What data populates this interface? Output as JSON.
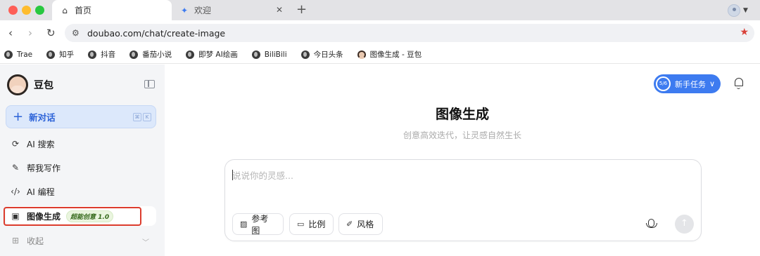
{
  "browser": {
    "tabs": [
      {
        "label": "首页",
        "icon": "home-icon"
      },
      {
        "label": "欢迎",
        "icon": "sparkle-icon"
      }
    ],
    "url": "doubao.com/chat/create-image",
    "bookmarks": [
      "Trae",
      "知乎",
      "抖音",
      "番茄小说",
      "即梦 AI绘画",
      "BiliBili",
      "今日头条",
      "图像生成 - 豆包"
    ]
  },
  "sidebar": {
    "brand": "豆包",
    "new_chat": "新对话",
    "shortcut_keys": [
      "⌘",
      "K"
    ],
    "items": [
      {
        "label": "AI 搜索",
        "icon": "search-icon"
      },
      {
        "label": "帮我写作",
        "icon": "pen-icon"
      },
      {
        "label": "AI 编程",
        "icon": "code-icon"
      },
      {
        "label": "图像生成",
        "icon": "image-plus-icon",
        "badge": "超能创意 1.0"
      },
      {
        "label": "收起",
        "icon": "grid-icon"
      }
    ]
  },
  "main": {
    "task_progress": "5/6",
    "task_label": "新手任务",
    "title": "图像生成",
    "subtitle": "创意高效迭代，让灵感自然生长",
    "composer": {
      "placeholder": "说说你的灵感...",
      "chips": [
        "参考图",
        "比例",
        "风格"
      ]
    }
  },
  "colors": {
    "accent_blue": "#3d7bf0",
    "highlight_red": "#dc3c2d",
    "bookmark_star": "#d9423a"
  }
}
